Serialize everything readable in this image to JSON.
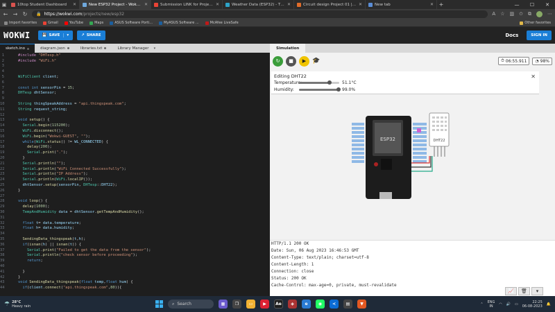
{
  "browser": {
    "tabs": [
      {
        "title": "10top Student Dashboard",
        "color": "#d9534f",
        "active": false
      },
      {
        "title": "New ESP32 Project - Wokwi Sim",
        "color": "#6fa8dc",
        "active": true
      },
      {
        "title": "Submission LINK for Projects on",
        "color": "#ea4335",
        "active": false
      },
      {
        "title": "Weather Data (ESP32) - ThingSp",
        "color": "#2ea3c8",
        "active": false
      },
      {
        "title": "Circuit design Project 01 | Tinker",
        "color": "#e06c2a",
        "active": false
      },
      {
        "title": "New tab",
        "color": "#5a8dd6",
        "active": false
      }
    ],
    "new_tab": "+",
    "win_min": "—",
    "win_max": "☐",
    "win_close": "✕",
    "url_host": "https://wokwi.com",
    "url_path": "/projects/new/esp32",
    "back": "←",
    "forward": "→",
    "reload": "↻"
  },
  "bookmarks": [
    {
      "label": "Import favorites",
      "color": "#888"
    },
    {
      "label": "Gmail",
      "color": "#ea4335"
    },
    {
      "label": "YouTube",
      "color": "#ff0000"
    },
    {
      "label": "Maps",
      "color": "#34a853"
    },
    {
      "label": "ASUS Software Porti...",
      "color": "#1b5e9e"
    },
    {
      "label": "MyASUS Software ...",
      "color": "#1b5e9e"
    },
    {
      "label": "McAfee LiveSafe",
      "color": "#c01818"
    }
  ],
  "other_favorites": "Other favorites",
  "wokwi": {
    "logo": "WOKWI",
    "save": "SAVE",
    "share": "SHARE",
    "docs": "Docs",
    "signin": "SIGN IN"
  },
  "editor_tabs": [
    {
      "label": "sketch.ino",
      "active": true
    },
    {
      "label": "diagram.json",
      "active": false
    },
    {
      "label": "libraries.txt",
      "active": false
    },
    {
      "label": "Library Manager",
      "active": false
    }
  ],
  "code_lines": [
    {
      "n": "1",
      "html": "<span class='pp'>#include</span> <span class='st'>\"DHTesp.h\"</span>"
    },
    {
      "n": "2",
      "html": "<span class='pp'>#include</span> <span class='st'>\"WiFi.h\"</span>"
    },
    {
      "n": "3",
      "html": ""
    },
    {
      "n": "4",
      "html": ""
    },
    {
      "n": "5",
      "html": "<span class='ty'>WiFiClient</span> <span class='va'>client</span>;"
    },
    {
      "n": "6",
      "html": ""
    },
    {
      "n": "7",
      "html": "<span class='kw'>const</span> <span class='kw'>int</span> <span class='va'>sensorPin</span> = <span class='nu'>15</span>;"
    },
    {
      "n": "8",
      "html": "<span class='ty'>DHTesp</span> <span class='va'>dhtSensor</span>;"
    },
    {
      "n": "9",
      "html": ""
    },
    {
      "n": "10",
      "html": "<span class='ty'>String</span> <span class='va'>thingSpeakAddress</span> = <span class='st'>\"api.thingspeak.com\"</span>;"
    },
    {
      "n": "11",
      "html": "<span class='ty'>String</span> <span class='va'>request_string</span>;"
    },
    {
      "n": "12",
      "html": ""
    },
    {
      "n": "13",
      "html": "<span class='kw'>void</span> <span class='fn'>setup</span>() {"
    },
    {
      "n": "14",
      "html": "  <span class='ty'>Serial</span>.<span class='fn'>begin</span>(<span class='nu'>115200</span>);"
    },
    {
      "n": "15",
      "html": "  <span class='ty'>WiFi</span>.<span class='fn'>disconnect</span>();"
    },
    {
      "n": "16",
      "html": "  <span class='ty'>WiFi</span>.<span class='fn'>begin</span>(<span class='st'>\"Wokwi-GUEST\"</span>, <span class='st'>\"\"</span>);"
    },
    {
      "n": "17",
      "html": "  <span class='kw'>while</span>(<span class='ty'>WiFi</span>.<span class='fn'>status</span>() != <span class='va'>WL_CONNECTED</span>) {"
    },
    {
      "n": "18",
      "html": "    <span class='fn'>delay</span>(<span class='nu'>200</span>);"
    },
    {
      "n": "19",
      "html": "    <span class='ty'>Serial</span>.<span class='fn'>print</span>(<span class='st'>\".\"</span>);"
    },
    {
      "n": "20",
      "html": "  }"
    },
    {
      "n": "21",
      "html": "  <span class='ty'>Serial</span>.<span class='fn'>println</span>(<span class='st'>\"\"</span>);"
    },
    {
      "n": "22",
      "html": "  <span class='ty'>Serial</span>.<span class='fn'>println</span>(<span class='st'>\"WiFi Connected Successfully\"</span>);"
    },
    {
      "n": "23",
      "html": "  <span class='ty'>Serial</span>.<span class='fn'>println</span>(<span class='st'>\"IP Address\"</span>);"
    },
    {
      "n": "24",
      "html": "  <span class='ty'>Serial</span>.<span class='fn'>println</span>(<span class='ty'>WiFi</span>.<span class='fn'>localIP</span>());"
    },
    {
      "n": "25",
      "html": "  <span class='va'>dhtSensor</span>.<span class='fn'>setup</span>(<span class='va'>sensorPin</span>, <span class='ty'>DHTesp</span>::<span class='va'>DHT22</span>);"
    },
    {
      "n": "26",
      "html": "}"
    },
    {
      "n": "27",
      "html": ""
    },
    {
      "n": "28",
      "html": "<span class='kw'>void</span> <span class='fn'>loop</span>() {"
    },
    {
      "n": "29",
      "html": "  <span class='fn'>delay</span>(<span class='nu'>1000</span>);"
    },
    {
      "n": "30",
      "html": "  <span class='ty'>TempAndHumidity</span> <span class='va'>data</span> = <span class='va'>dhtSensor</span>.<span class='fn'>getTempAndHumidity</span>();"
    },
    {
      "n": "31",
      "html": ""
    },
    {
      "n": "32",
      "html": "  <span class='kw'>float</span> <span class='va'>t</span>= <span class='va'>data</span>.<span class='va'>temperature</span>;"
    },
    {
      "n": "33",
      "html": "  <span class='kw'>float</span> <span class='va'>h</span>= <span class='va'>data</span>.<span class='va'>humidity</span>;"
    },
    {
      "n": "34",
      "html": ""
    },
    {
      "n": "35",
      "html": "  <span class='fn'>SendingData_thingspeak</span>(<span class='va'>t</span>,<span class='va'>h</span>);"
    },
    {
      "n": "36",
      "html": "  <span class='kw'>if</span>(<span class='fn'>isnan</span>(<span class='va'>h</span>) || <span class='fn'>isnan</span>(<span class='va'>t</span>)) {"
    },
    {
      "n": "37",
      "html": "    <span class='ty'>Serial</span>.<span class='fn'>print</span>(<span class='st'>\"Failed to get the data from the sensor\"</span>);"
    },
    {
      "n": "38",
      "html": "    <span class='ty'>Serial</span>.<span class='fn'>println</span>(<span class='st'>\"check sensor before proceeding\"</span>);"
    },
    {
      "n": "39",
      "html": "    <span class='kw'>return</span>;"
    },
    {
      "n": "40",
      "html": ""
    },
    {
      "n": "41",
      "html": "  }"
    },
    {
      "n": "42",
      "html": "}"
    },
    {
      "n": "43",
      "html": "<span class='kw'>void</span> <span class='fn'>SendingData_thingspeak</span>(<span class='kw'>float</span> <span class='va'>temp</span>,<span class='kw'>float</span> <span class='va'>hum</span>) {"
    },
    {
      "n": "44",
      "html": "  <span class='kw'>if</span>(<span class='va'>client</span>.<span class='fn'>connect</span>(<span class='st'>\"api.thingspeak.com\"</span>,<span class='nu'>80</span>)){"
    }
  ],
  "simulation": {
    "tab": "Simulation",
    "timer": "06:55.911",
    "cpu": "98%",
    "dht_title": "Editing DHT22",
    "temp_label": "Temperature:",
    "temp_value": "51.1°C",
    "temp_fraction": 0.76,
    "hum_label": "Humidity:",
    "hum_value": "99.0%",
    "hum_fraction": 0.99,
    "chip_label": "ESP32",
    "sensor_label": "DHT22"
  },
  "serial_lines": [
    "HTTP/1.1 200 OK",
    "Date: Sun, 06 Aug 2023 16:46:53 GMT",
    "Content-Type: text/plain; charset=utf-8",
    "Content-Length: 1",
    "Connection: close",
    "Status: 200 OK",
    "Cache-Control: max-age=0, private, must-revalidate"
  ],
  "taskbar": {
    "weather_temp": "28°C",
    "weather_desc": "Heavy rain",
    "search": "Search",
    "lang1": "ENG",
    "lang2": "IN",
    "time": "22:25",
    "date": "06-08-2023"
  }
}
